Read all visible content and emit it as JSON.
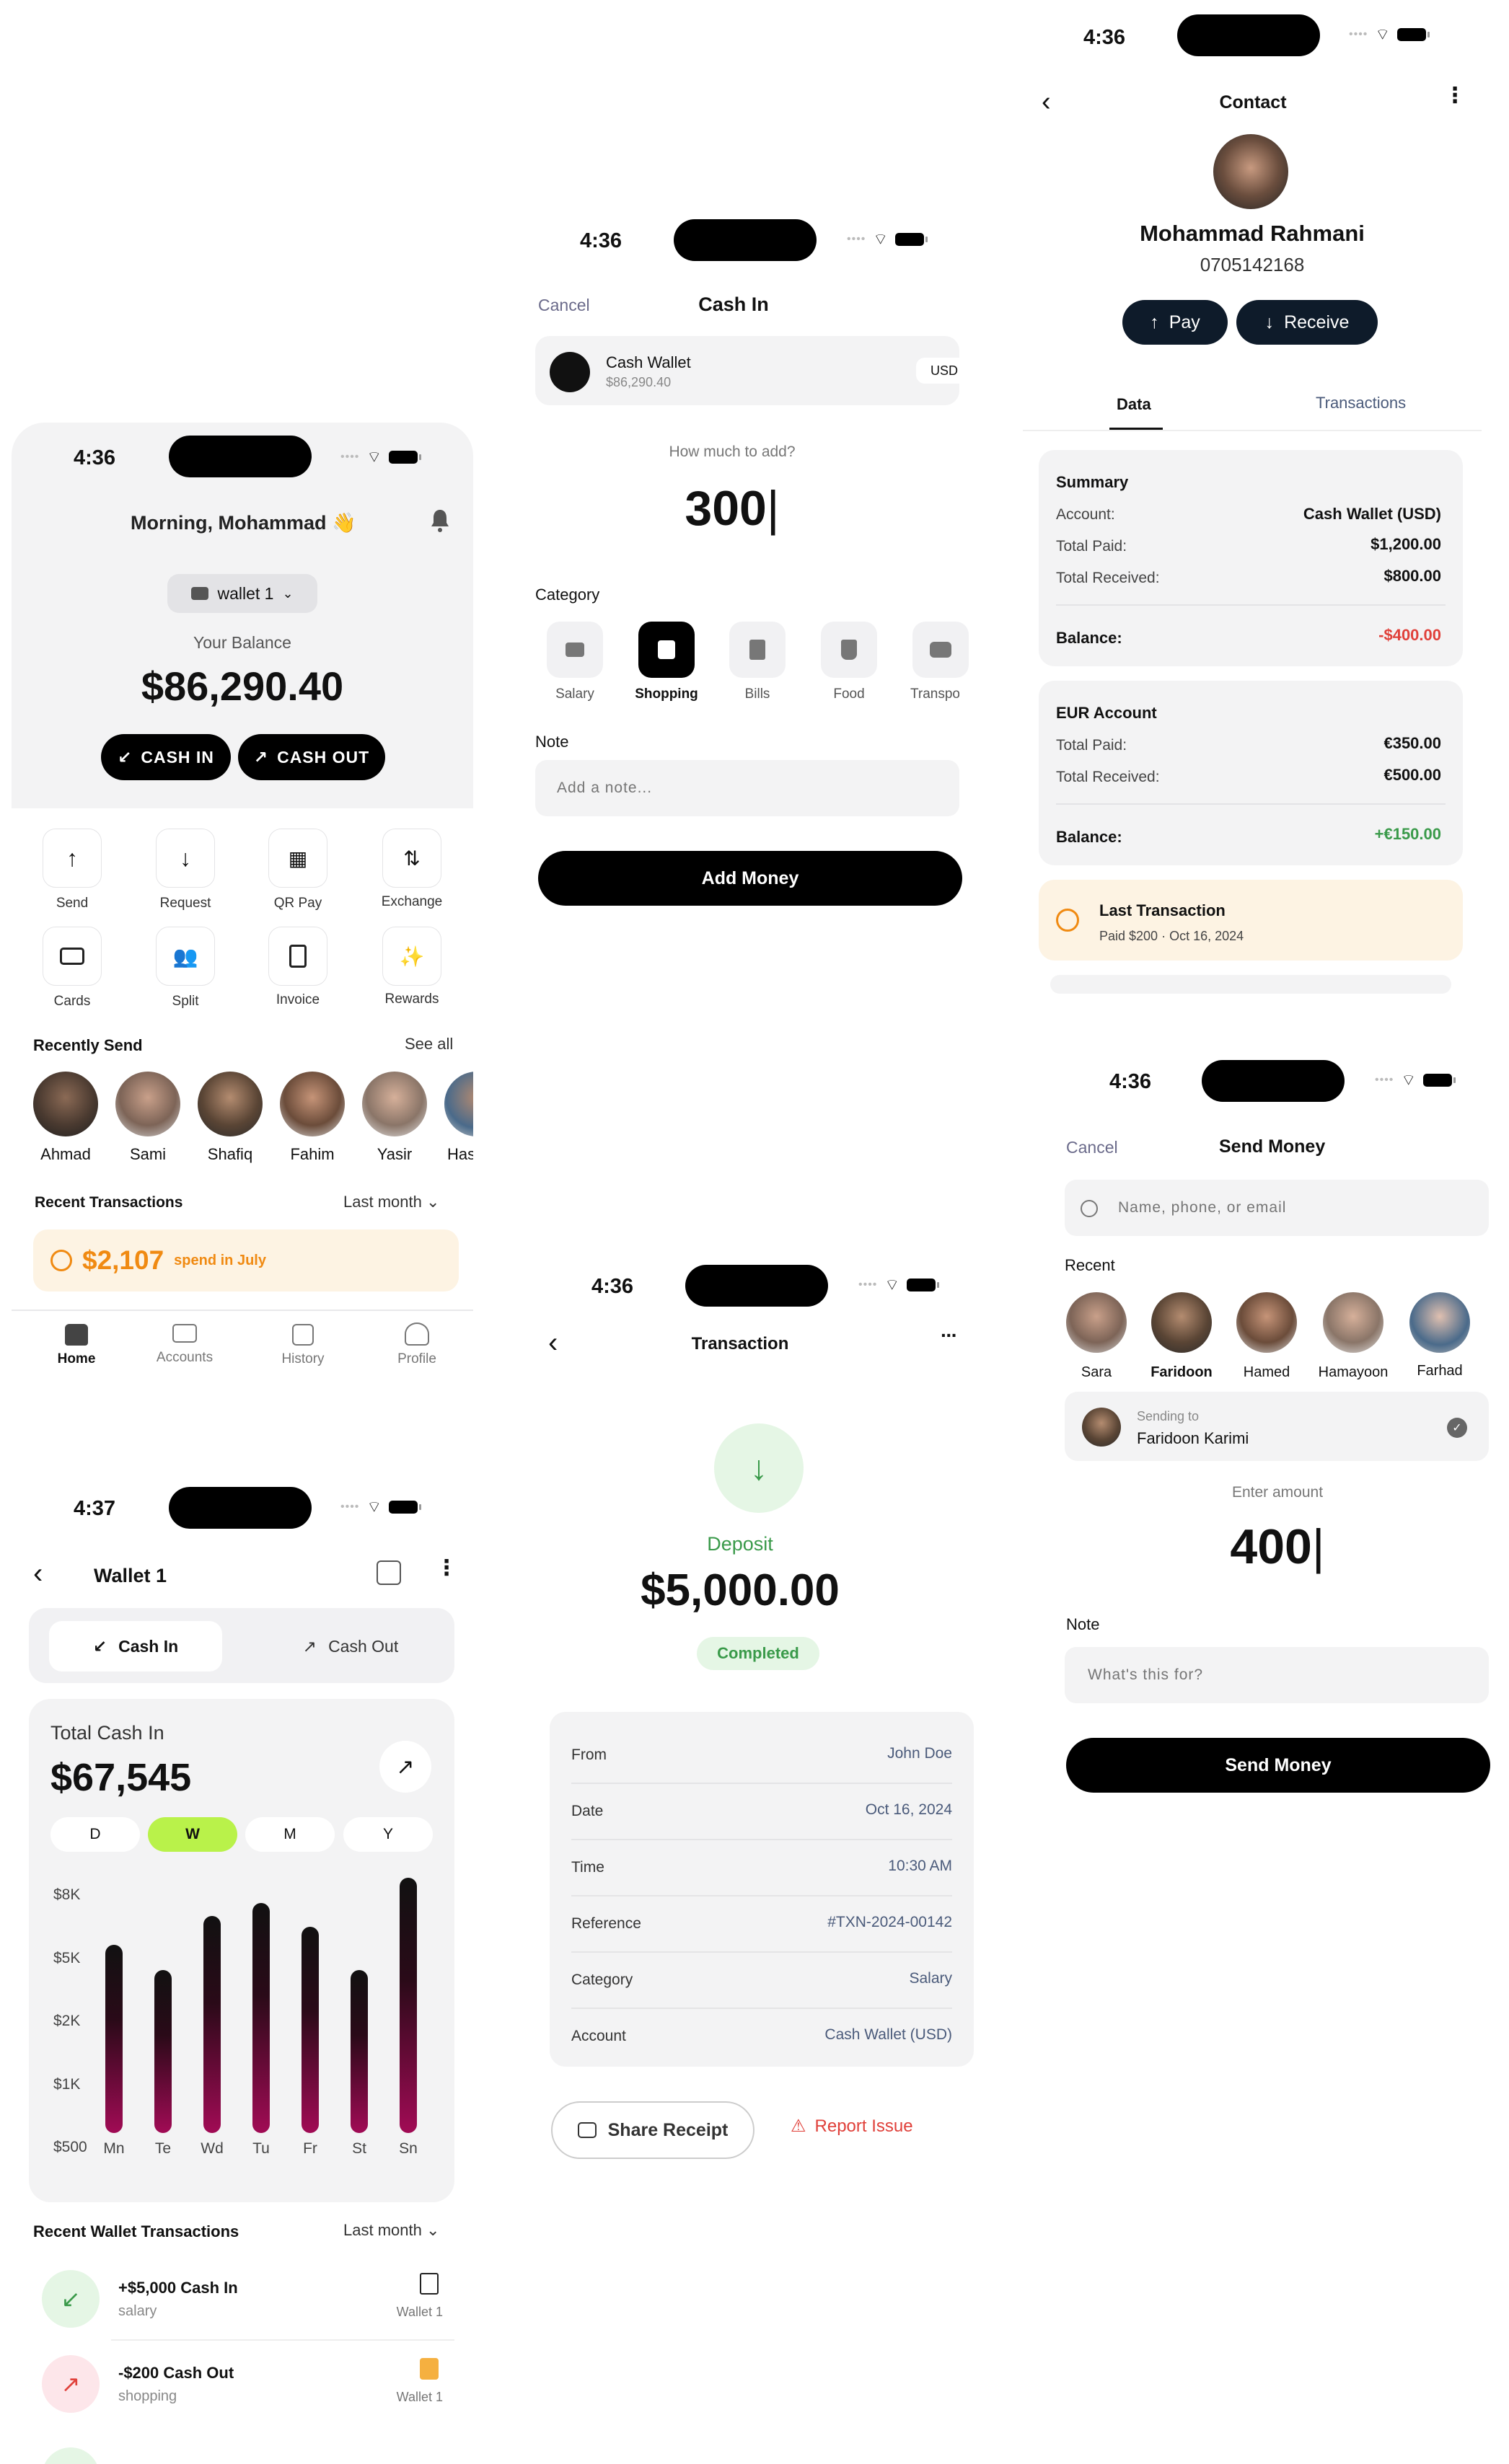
{
  "home": {
    "time": "4:36",
    "greeting": "Morning, Mohammad 👋",
    "wallet": "wallet 1",
    "balance_label": "Your Balance",
    "balance": "$86,290.40",
    "cash_in": "CASH IN",
    "cash_out": "CASH OUT",
    "actions": [
      {
        "label": "Send",
        "icon": "arrow-up-icon"
      },
      {
        "label": "Request",
        "icon": "arrow-down-icon"
      },
      {
        "label": "QR Pay",
        "icon": "qr-icon"
      },
      {
        "label": "Exchange",
        "icon": "exchange-icon"
      },
      {
        "label": "Cards",
        "icon": "card-icon"
      },
      {
        "label": "Split",
        "icon": "users-icon"
      },
      {
        "label": "Invoice",
        "icon": "invoice-icon"
      },
      {
        "label": "Rewards",
        "icon": "sparkle-icon"
      }
    ],
    "recent_title": "Recently Send",
    "see_all": "See all",
    "recent": [
      "Ahmad",
      "Sami",
      "Shafiq",
      "Fahim",
      "Yasir",
      "Has"
    ],
    "tx_title": "Recent Transactions",
    "tx_filter": "Last month",
    "spend_amount": "$2,107",
    "spend_text": "spend in July",
    "nav": [
      "Home",
      "Accounts",
      "History",
      "Profile"
    ]
  },
  "cashin": {
    "time": "4:36",
    "cancel": "Cancel",
    "title": "Cash In",
    "wallet_name": "Cash Wallet",
    "wallet_balance": "$86,290.40",
    "currency": "USD",
    "question": "How much to add?",
    "amount": "300",
    "category_label": "Category",
    "categories": [
      "Salary",
      "Shopping",
      "Bills",
      "Food",
      "Transpo"
    ],
    "note_label": "Note",
    "note_placeholder": "Add a note...",
    "button": "Add Money"
  },
  "contact": {
    "time": "4:36",
    "title": "Contact",
    "name": "Mohammad Rahmani",
    "phone": "0705142168",
    "pay": "Pay",
    "receive": "Receive",
    "tabs": [
      "Data",
      "Transactions"
    ],
    "summary": {
      "title": "Summary",
      "rows": [
        [
          "Account:",
          "Cash Wallet (USD)"
        ],
        [
          "Total Paid:",
          "$1,200.00"
        ],
        [
          "Total Received:",
          "$800.00"
        ]
      ],
      "balance_label": "Balance:",
      "balance": "-$400.00"
    },
    "eur": {
      "title": "EUR Account",
      "rows": [
        [
          "Total Paid:",
          "€350.00"
        ],
        [
          "Total Received:",
          "€500.00"
        ]
      ],
      "balance_label": "Balance:",
      "balance": "+€150.00"
    },
    "last": {
      "title": "Last Transaction",
      "sub": "Paid $200 · Oct 16, 2024"
    }
  },
  "send": {
    "time": "4:36",
    "cancel": "Cancel",
    "title": "Send Money",
    "search_placeholder": "Name, phone, or email",
    "recent_label": "Recent",
    "recent": [
      "Sara",
      "Faridoon",
      "Hamed",
      "Hamayoon",
      "Farhad"
    ],
    "sending_to_label": "Sending to",
    "sending_to": "Faridoon Karimi",
    "enter_amount": "Enter amount",
    "amount": "400",
    "note_label": "Note",
    "note_placeholder": "What's this for?",
    "button": "Send Money"
  },
  "wallet": {
    "time": "4:37",
    "title": "Wallet 1",
    "tab_in": "Cash In",
    "tab_out": "Cash Out",
    "total_label": "Total Cash In",
    "total": "$67,545",
    "periods": [
      "D",
      "W",
      "M",
      "Y"
    ],
    "chart_data": {
      "type": "bar",
      "categories": [
        "Mn",
        "Te",
        "Wd",
        "Tu",
        "Fr",
        "St",
        "Sn"
      ],
      "y_ticks": [
        "$8K",
        "$5K",
        "$2K",
        "$1K",
        "$500"
      ],
      "values": [
        0.73,
        0.63,
        0.84,
        0.89,
        0.8,
        0.63,
        0.99
      ],
      "value_unit": "fraction of axis height",
      "color": "#a10b55"
    },
    "recent_title": "Recent Wallet Transactions",
    "filter": "Last month",
    "tx": [
      {
        "title": "+$5,000 Cash In",
        "sub": "salary",
        "wallet": "Wallet 1"
      },
      {
        "title": "-$200 Cash Out",
        "sub": "shopping",
        "wallet": "Wallet 1"
      }
    ]
  },
  "transaction": {
    "time": "4:36",
    "title": "Transaction",
    "type": "Deposit",
    "amount": "$5,000.00",
    "status": "Completed",
    "rows": [
      [
        "From",
        "John Doe"
      ],
      [
        "Date",
        "Oct 16, 2024"
      ],
      [
        "Time",
        "10:30 AM"
      ],
      [
        "Reference",
        "#TXN-2024-00142"
      ],
      [
        "Category",
        "Salary"
      ],
      [
        "Account",
        "Cash Wallet (USD)"
      ]
    ],
    "share": "Share Receipt",
    "report": "Report Issue"
  },
  "colors": {
    "accent": "#000000",
    "lime": "#b9f24a",
    "orange": "#f08a12",
    "red": "#e0403a",
    "green": "#3a9a4a",
    "magenta": "#a10b55"
  }
}
